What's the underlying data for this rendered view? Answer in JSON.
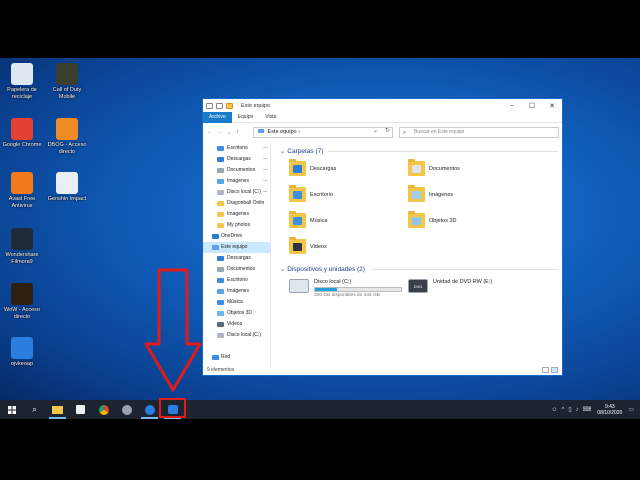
{
  "window": {
    "title": "Este equipo",
    "ribbon_tabs": [
      "Archivo",
      "Equipo",
      "Vista"
    ],
    "address": "Este equipo",
    "search_placeholder": "Buscar en Este equipo",
    "nav_pane": [
      {
        "label": "Escritorio",
        "pinned": true,
        "color": "#3d8fe0",
        "sel": false,
        "lvl": 1
      },
      {
        "label": "Descargas",
        "pinned": true,
        "color": "#2f7ed8",
        "sel": false,
        "lvl": 1
      },
      {
        "label": "Documentos",
        "pinned": true,
        "color": "#9aa5b1",
        "sel": false,
        "lvl": 1
      },
      {
        "label": "Imágenes",
        "pinned": true,
        "color": "#57a7e8",
        "sel": false,
        "lvl": 1
      },
      {
        "label": "Disco local (C:)",
        "pinned": true,
        "color": "#b0b8c2",
        "sel": false,
        "lvl": 1
      },
      {
        "label": "Dragonball Onlin",
        "pinned": false,
        "color": "#f3c64a",
        "sel": false,
        "lvl": 1
      },
      {
        "label": "Imágenes",
        "pinned": false,
        "color": "#f3c64a",
        "sel": false,
        "lvl": 1
      },
      {
        "label": "My photos",
        "pinned": false,
        "color": "#f3c64a",
        "sel": false,
        "lvl": 1
      },
      {
        "label": "OneDrive",
        "pinned": false,
        "color": "#2b7cd3",
        "sel": false,
        "lvl": 0
      },
      {
        "label": "Este equipo",
        "pinned": false,
        "color": "#5aa0e6",
        "sel": true,
        "lvl": 0
      },
      {
        "label": "Descargas",
        "pinned": false,
        "color": "#2f7ed8",
        "sel": false,
        "lvl": 1
      },
      {
        "label": "Documentos",
        "pinned": false,
        "color": "#9aa5b1",
        "sel": false,
        "lvl": 1
      },
      {
        "label": "Escritorio",
        "pinned": false,
        "color": "#3d8fe0",
        "sel": false,
        "lvl": 1
      },
      {
        "label": "Imágenes",
        "pinned": false,
        "color": "#57a7e8",
        "sel": false,
        "lvl": 1
      },
      {
        "label": "Música",
        "pinned": false,
        "color": "#3d8fe0",
        "sel": false,
        "lvl": 1
      },
      {
        "label": "Objetos 3D",
        "pinned": false,
        "color": "#6fb4ea",
        "sel": false,
        "lvl": 1
      },
      {
        "label": "Videos",
        "pinned": false,
        "color": "#5d6b7a",
        "sel": false,
        "lvl": 1
      },
      {
        "label": "Disco local (C:)",
        "pinned": false,
        "color": "#b0b8c2",
        "sel": false,
        "lvl": 1
      },
      {
        "label": "",
        "pinned": false,
        "color": "#ffffff",
        "sel": false,
        "lvl": 1
      },
      {
        "label": "Red",
        "pinned": false,
        "color": "#3d8fe0",
        "sel": false,
        "lvl": 0
      }
    ],
    "folders_header": "Carpetas (7)",
    "folders": [
      {
        "label": "Descargas",
        "badge": "#2f7ed8"
      },
      {
        "label": "Documentos",
        "badge": "#dfe5ea"
      },
      {
        "label": "Escritorio",
        "badge": "#3d8fe0"
      },
      {
        "label": "Imágenes",
        "badge": "#9fd0f5"
      },
      {
        "label": "Música",
        "badge": "#3d8fe0"
      },
      {
        "label": "Objetos 3D",
        "badge": "#8ec8f0"
      },
      {
        "label": "Videos",
        "badge": "#2b3440"
      }
    ],
    "devices_header": "Dispositivos y unidades (2)",
    "drives": [
      {
        "label": "Disco local (C:)",
        "sub": "330 GB disponibles de 445 GB",
        "used": 0.26,
        "kind": "hdd"
      },
      {
        "label": "Unidad de DVD RW (E:)",
        "sub": "",
        "used": null,
        "kind": "dvd"
      }
    ],
    "dvd_text": "DVD",
    "status": "9 elementos"
  },
  "desktop_icons": [
    {
      "label": "Papelera de reciclaje",
      "color": "#dfe8f0"
    },
    {
      "label": "Call of Duty Mobile",
      "color": "#3a3f2e"
    },
    {
      "label": "Google Chrome",
      "color": "#e34133"
    },
    {
      "label": "DBOG - Acceso directo",
      "color": "#f08a24"
    },
    {
      "label": "Avast Free Antivirus",
      "color": "#f27c1b"
    },
    {
      "label": "Genshin Impact",
      "color": "#e9eef5"
    },
    {
      "label": "Wondershare Filmora9",
      "color": "#1f2a38"
    },
    {
      "label": "WoW - Acceso directo",
      "color": "#2c2010"
    },
    {
      "label": "ojvkeoap",
      "color": "#2b7de0"
    }
  ],
  "taskbar": {
    "apps": [
      "start",
      "search",
      "explorer",
      "store",
      "chrome",
      "wow",
      "edge",
      "ojvkeoap"
    ],
    "time": "9:43",
    "date": "08/10/2020",
    "highlight_color": "#e01b1b"
  }
}
